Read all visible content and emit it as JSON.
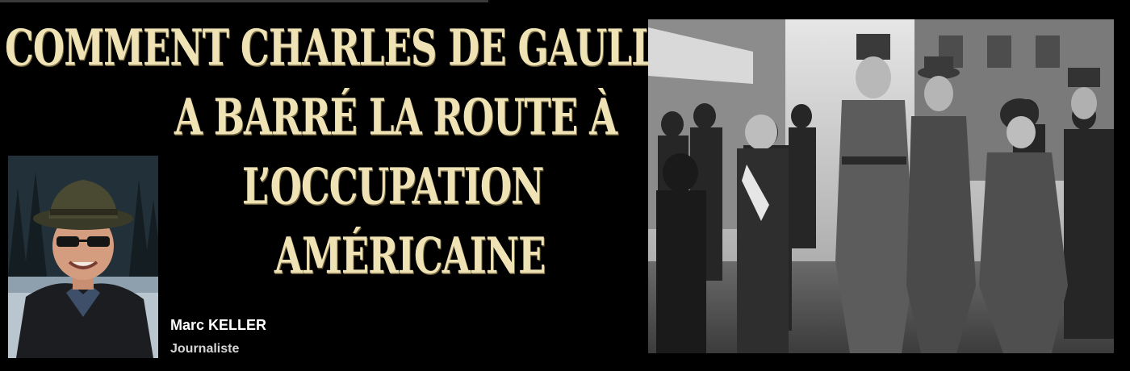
{
  "headline": {
    "line1": "COMMENT CHARLES DE GAULLE",
    "line2": "A BARRÉ LA ROUTE À",
    "line3": "L’OCCUPATION",
    "line4": "AMÉRICAINE"
  },
  "author": {
    "name": "Marc KELLER",
    "role": "Journaliste"
  },
  "colors": {
    "headline": "#efe2b4",
    "background": "#000000",
    "author_name": "#ffffff",
    "author_role": "#d6d6d6"
  }
}
